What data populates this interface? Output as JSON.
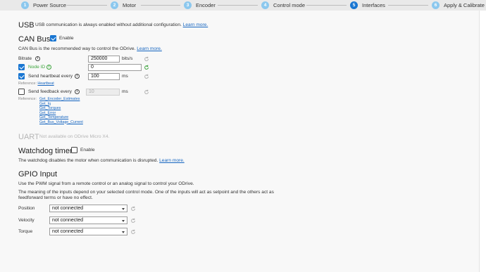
{
  "stepper": {
    "steps": [
      {
        "num": "1",
        "label": "Power Source"
      },
      {
        "num": "2",
        "label": "Motor"
      },
      {
        "num": "3",
        "label": "Encoder"
      },
      {
        "num": "4",
        "label": "Control mode"
      },
      {
        "num": "5",
        "label": "Interfaces"
      },
      {
        "num": "6",
        "label": "Apply & Calibrate"
      }
    ]
  },
  "usb": {
    "title": "USB",
    "desc": "USB communication is always enabled without additional configuration.",
    "learn_more": "Learn more."
  },
  "can": {
    "title": "CAN Bus",
    "enable_label": "Enable",
    "desc": "CAN Bus is the recommended way to control the ODrive.",
    "learn_more": "Learn more.",
    "bitrate_label": "Bitrate",
    "bitrate_value": "250000",
    "bitrate_unit": "bits/s",
    "node_id_label": "Node ID",
    "node_id_value": "0",
    "heartbeat_label": "Send heartbeat every",
    "heartbeat_value": "100",
    "heartbeat_unit": "ms",
    "heartbeat_ref_label": "Reference:",
    "heartbeat_ref_link": "Heartbeat",
    "feedback_label": "Send feedback every",
    "feedback_value": "10",
    "feedback_unit": "ms",
    "feedback_ref_label": "Reference:",
    "feedback_refs": [
      "Get_Encoder_Estimates",
      "Get_Iq",
      "Get_Torques",
      "Get_Error",
      "Get_Temperature",
      "Get_Bus_Voltage_Current"
    ]
  },
  "uart": {
    "title": "UART",
    "desc": "Not available on ODrive Micro X4."
  },
  "watchdog": {
    "title": "Watchdog timer",
    "enable_label": "Enable",
    "desc": "The watchdog disables the motor when communication is disrupted.",
    "learn_more": "Learn more."
  },
  "gpio": {
    "title": "GPIO Input",
    "desc1": "Use the PWM signal from a remote control or an analog signal to control your ODrive.",
    "desc2_line1": "The meaning of the inputs depend on your selected control mode. One of the inputs will act as setpoint and the others act as",
    "desc2_line2": "feedforward terms or have no effect.",
    "rows": [
      {
        "label": "Position",
        "value": "not connected"
      },
      {
        "label": "Velocity",
        "value": "not connected"
      },
      {
        "label": "Torque",
        "value": "not connected"
      }
    ]
  },
  "colors": {
    "accent": "#1976d2",
    "step_inactive": "#8cc8ee",
    "link": "#1565c0",
    "node_id_green": "#3aa33a"
  }
}
